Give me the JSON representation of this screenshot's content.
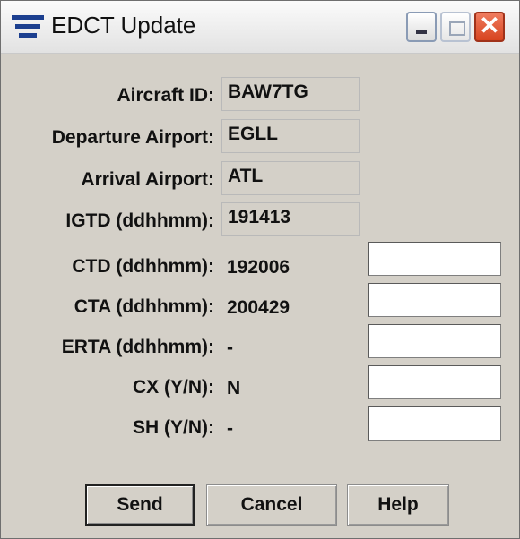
{
  "window": {
    "title": "EDCT Update",
    "icons": {
      "app": "menu-lines-icon",
      "minimize": "minimize-icon",
      "maximize": "maximize-icon",
      "close": "close-icon"
    },
    "close_glyph": "✕"
  },
  "fields": {
    "aircraft_id": {
      "label": "Aircraft ID:",
      "value": "BAW7TG"
    },
    "departure_airport": {
      "label": "Departure Airport:",
      "value": "EGLL"
    },
    "arrival_airport": {
      "label": "Arrival Airport:",
      "value": "ATL"
    },
    "igtd": {
      "label": "IGTD (ddhhmm):",
      "value": "191413"
    },
    "ctd": {
      "label": "CTD (ddhhmm):",
      "value": "192006",
      "input": ""
    },
    "cta": {
      "label": "CTA (ddhhmm):",
      "value": "200429",
      "input": ""
    },
    "erta": {
      "label": "ERTA (ddhhmm):",
      "value": "-",
      "input": ""
    },
    "cx": {
      "label": "CX (Y/N):",
      "value": "N",
      "input": ""
    },
    "sh": {
      "label": "SH (Y/N):",
      "value": "-",
      "input": ""
    }
  },
  "buttons": {
    "send": "Send",
    "cancel": "Cancel",
    "help": "Help"
  },
  "colors": {
    "window_bg": "#d4d0c8",
    "close_button": "#d7441f",
    "icon_blue": "#1c3f8f"
  }
}
